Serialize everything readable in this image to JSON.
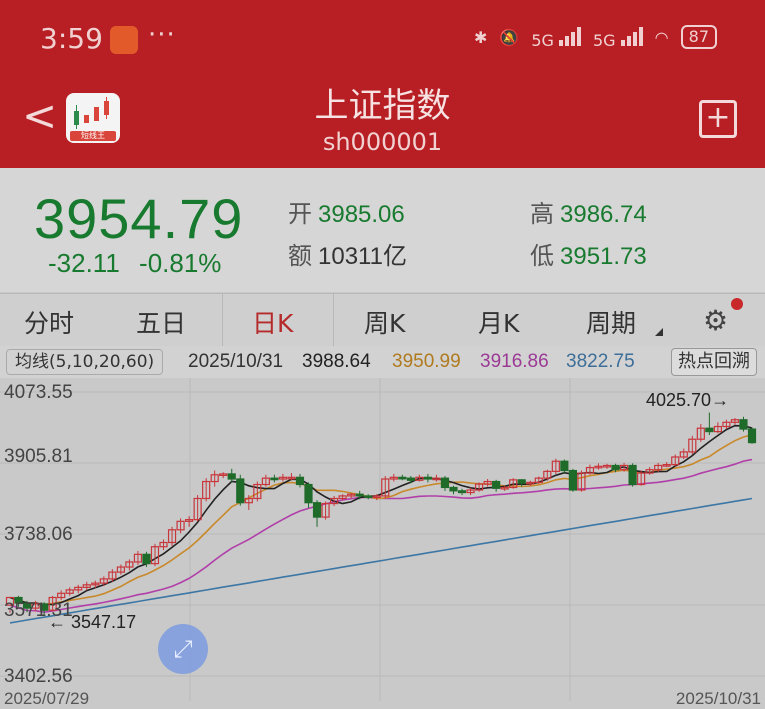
{
  "status_bar": {
    "time": "3:59",
    "more": "···",
    "network1": "5G",
    "network2": "5G",
    "battery": "87"
  },
  "header": {
    "title": "上证指数",
    "code": "sh000001",
    "logo_caption": "短线王"
  },
  "quote": {
    "price": "3954.79",
    "change": "-32.11",
    "change_pct": "-0.81%",
    "open_label": "开",
    "open": "3985.06",
    "high_label": "高",
    "high": "3986.74",
    "amount_label": "额",
    "amount": "10311亿",
    "low_label": "低",
    "low": "3951.73"
  },
  "tabs": [
    "分时",
    "五日",
    "日K",
    "周K",
    "月K",
    "周期"
  ],
  "active_tab": "日K",
  "ma_bar": {
    "selector": "均线(5,10,20,60)",
    "date": "2025/10/31",
    "ma5": "3988.64",
    "ma10": "3950.99",
    "ma20": "3916.86",
    "ma60": "3822.75",
    "hot_button": "热点回溯"
  },
  "colors": {
    "up": "#c8353a",
    "down": "#1f6b2a",
    "ma5": "#222222",
    "ma10": "#c9892a",
    "ma20": "#b13fa9",
    "ma60": "#3d77a5"
  },
  "chart_data": {
    "type": "candlestick",
    "y_ticks": [
      "4073.55",
      "3905.81",
      "3738.06",
      "3571.31",
      "3402.56"
    ],
    "ylim": [
      3402.56,
      4073.55
    ],
    "x_start": "2025/07/29",
    "x_end": "2025/10/31",
    "annotations": {
      "high": "4025.70",
      "low": "3547.17"
    },
    "candles": [
      [
        3570,
        3588,
        3558,
        3552
      ],
      [
        3588,
        3575,
        3592,
        3566
      ],
      [
        3575,
        3563,
        3580,
        3553
      ],
      [
        3563,
        3573,
        3580,
        3555
      ],
      [
        3573,
        3558,
        3577,
        3547
      ],
      [
        3558,
        3588,
        3592,
        3555
      ],
      [
        3588,
        3598,
        3605,
        3582
      ],
      [
        3598,
        3606,
        3612,
        3592
      ],
      [
        3606,
        3612,
        3618,
        3598
      ],
      [
        3612,
        3618,
        3625,
        3605
      ],
      [
        3618,
        3622,
        3628,
        3610
      ],
      [
        3622,
        3632,
        3638,
        3615
      ],
      [
        3632,
        3648,
        3655,
        3625
      ],
      [
        3648,
        3660,
        3666,
        3642
      ],
      [
        3660,
        3672,
        3678,
        3652
      ],
      [
        3672,
        3690,
        3698,
        3665
      ],
      [
        3690,
        3668,
        3696,
        3660
      ],
      [
        3668,
        3708,
        3715,
        3662
      ],
      [
        3708,
        3718,
        3725,
        3700
      ],
      [
        3718,
        3748,
        3755,
        3710
      ],
      [
        3748,
        3768,
        3775,
        3740
      ],
      [
        3768,
        3772,
        3780,
        3755
      ],
      [
        3772,
        3822,
        3830,
        3768
      ],
      [
        3822,
        3862,
        3870,
        3815
      ],
      [
        3862,
        3878,
        3888,
        3850
      ],
      [
        3878,
        3880,
        3884,
        3870
      ],
      [
        3880,
        3868,
        3892,
        3860
      ],
      [
        3868,
        3812,
        3878,
        3805
      ],
      [
        3812,
        3822,
        3830,
        3795
      ],
      [
        3822,
        3855,
        3862,
        3815
      ],
      [
        3855,
        3870,
        3878,
        3850
      ],
      [
        3870,
        3868,
        3878,
        3860
      ],
      [
        3868,
        3872,
        3880,
        3862
      ],
      [
        3872,
        3872,
        3882,
        3865
      ],
      [
        3872,
        3855,
        3880,
        3848
      ],
      [
        3855,
        3812,
        3860,
        3800
      ],
      [
        3812,
        3778,
        3818,
        3755
      ],
      [
        3778,
        3810,
        3815,
        3772
      ],
      [
        3810,
        3822,
        3828,
        3804
      ],
      [
        3822,
        3828,
        3832,
        3818
      ],
      [
        3828,
        3832,
        3835,
        3822
      ],
      [
        3832,
        3828,
        3840,
        3820
      ],
      [
        3828,
        3825,
        3832,
        3820
      ],
      [
        3825,
        3828,
        3832,
        3818
      ],
      [
        3828,
        3868,
        3875,
        3822
      ],
      [
        3868,
        3872,
        3880,
        3862
      ],
      [
        3872,
        3870,
        3878,
        3865
      ],
      [
        3870,
        3865,
        3875,
        3858
      ],
      [
        3865,
        3872,
        3878,
        3862
      ],
      [
        3872,
        3868,
        3880,
        3860
      ],
      [
        3868,
        3870,
        3878,
        3862
      ],
      [
        3870,
        3848,
        3875,
        3840
      ],
      [
        3848,
        3840,
        3852,
        3832
      ],
      [
        3840,
        3836,
        3845,
        3830
      ],
      [
        3836,
        3842,
        3848,
        3830
      ],
      [
        3842,
        3856,
        3860,
        3838
      ],
      [
        3856,
        3862,
        3868,
        3850
      ],
      [
        3862,
        3846,
        3866,
        3838
      ],
      [
        3846,
        3848,
        3852,
        3840
      ],
      [
        3848,
        3866,
        3870,
        3845
      ],
      [
        3866,
        3858,
        3868,
        3850
      ],
      [
        3858,
        3860,
        3864,
        3852
      ],
      [
        3860,
        3870,
        3874,
        3856
      ],
      [
        3870,
        3886,
        3890,
        3864
      ],
      [
        3886,
        3910,
        3916,
        3880
      ],
      [
        3910,
        3888,
        3914,
        3880
      ],
      [
        3888,
        3842,
        3892,
        3838
      ],
      [
        3842,
        3882,
        3888,
        3838
      ],
      [
        3882,
        3895,
        3902,
        3878
      ],
      [
        3895,
        3898,
        3905,
        3890
      ],
      [
        3898,
        3900,
        3904,
        3892
      ],
      [
        3900,
        3890,
        3904,
        3884
      ],
      [
        3890,
        3900,
        3906,
        3885
      ],
      [
        3900,
        3855,
        3905,
        3850
      ],
      [
        3855,
        3882,
        3888,
        3852
      ],
      [
        3882,
        3890,
        3896,
        3878
      ],
      [
        3890,
        3900,
        3906,
        3884
      ],
      [
        3900,
        3902,
        3908,
        3896
      ],
      [
        3902,
        3920,
        3926,
        3898
      ],
      [
        3920,
        3932,
        3940,
        3915
      ],
      [
        3932,
        3962,
        3970,
        3926
      ],
      [
        3962,
        3988,
        3998,
        3956
      ],
      [
        3988,
        3980,
        4025,
        3972
      ],
      [
        3980,
        3992,
        4002,
        3976
      ],
      [
        3992,
        4002,
        4008,
        3986
      ],
      [
        4002,
        4008,
        4012,
        3996
      ],
      [
        4008,
        3986,
        4015,
        3980
      ],
      [
        3986,
        3954,
        3990,
        3951
      ]
    ]
  }
}
